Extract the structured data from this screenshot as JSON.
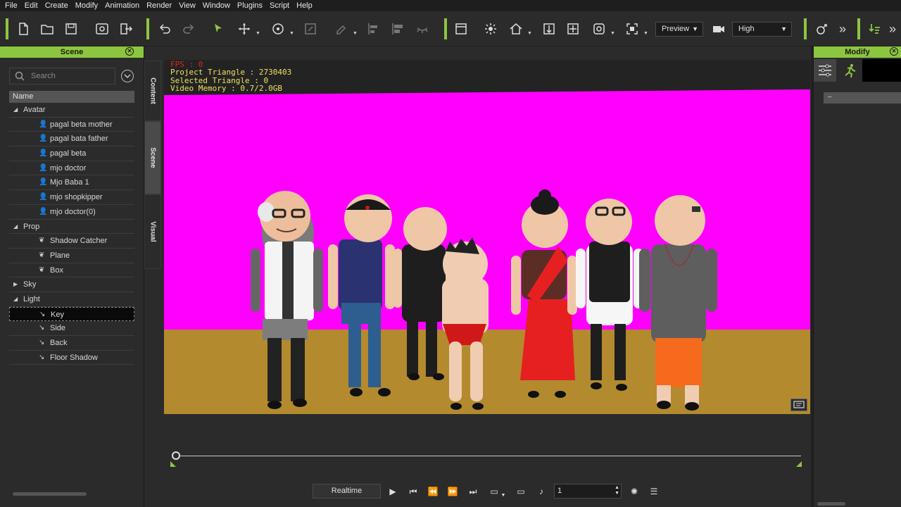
{
  "menu": [
    "File",
    "Edit",
    "Create",
    "Modify",
    "Animation",
    "Render",
    "View",
    "Window",
    "Plugins",
    "Script",
    "Help"
  ],
  "toolbar": {
    "preview_select": "Preview",
    "quality_select": "High",
    "overflow_label": "»",
    "accent_color": "#8cc63f"
  },
  "scene_panel": {
    "title": "Scene",
    "search_placeholder": "Search",
    "column_header": "Name",
    "groups": [
      {
        "label": "Avatar",
        "expanded": true,
        "items": [
          "pagal beta mother",
          "pagal bata father",
          "pagal beta",
          "mjo doctor",
          "Mjo Baba 1",
          "mjo shopkipper",
          "mjo doctor(0)"
        ]
      },
      {
        "label": "Prop",
        "expanded": true,
        "items": [
          "Shadow Catcher",
          "Plane",
          "Box"
        ]
      },
      {
        "label": "Sky",
        "expanded": false,
        "items": []
      },
      {
        "label": "Light",
        "expanded": true,
        "items": [
          "Key",
          "Side",
          "Back",
          "Floor Shadow"
        ]
      }
    ],
    "selected_item": "Key"
  },
  "vertical_tabs": [
    "Content",
    "Scene",
    "Visual"
  ],
  "viewport": {
    "fps": "FPS : 0",
    "project_triangle": "Project Triangle : 2730403",
    "selected_triangle": "Selected Triangle : 0",
    "video_memory": "Video Memory : 0.7/2.0GB",
    "background_color": "#ff00ff",
    "floor_color": "#b38a2e"
  },
  "playback": {
    "realtime_label": "Realtime",
    "frame_value": "1"
  },
  "modify_panel": {
    "title": "Modify",
    "bar_label": "–"
  }
}
